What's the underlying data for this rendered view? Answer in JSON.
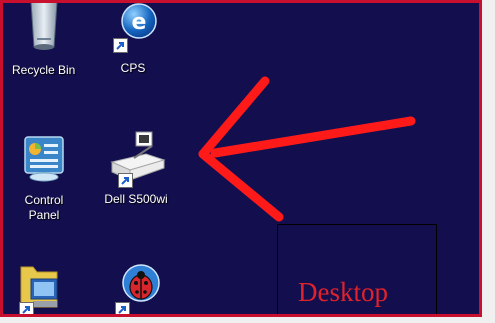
{
  "desktop": {
    "label": "Desktop",
    "icons": [
      {
        "name": "recycle-bin",
        "label": "Recycle Bin"
      },
      {
        "name": "cps",
        "label": "CPS"
      },
      {
        "name": "control-panel",
        "label": "Control\nPanel"
      },
      {
        "name": "dell-s500wi",
        "label": "Dell S500wi"
      },
      {
        "name": "folder-computer",
        "label": ""
      },
      {
        "name": "ladybug-app",
        "label": ""
      }
    ]
  },
  "colors": {
    "background": "#130f4e",
    "border": "#c8102e",
    "arrow": "#ff1a1a",
    "annotation_text": "#e0222a"
  }
}
